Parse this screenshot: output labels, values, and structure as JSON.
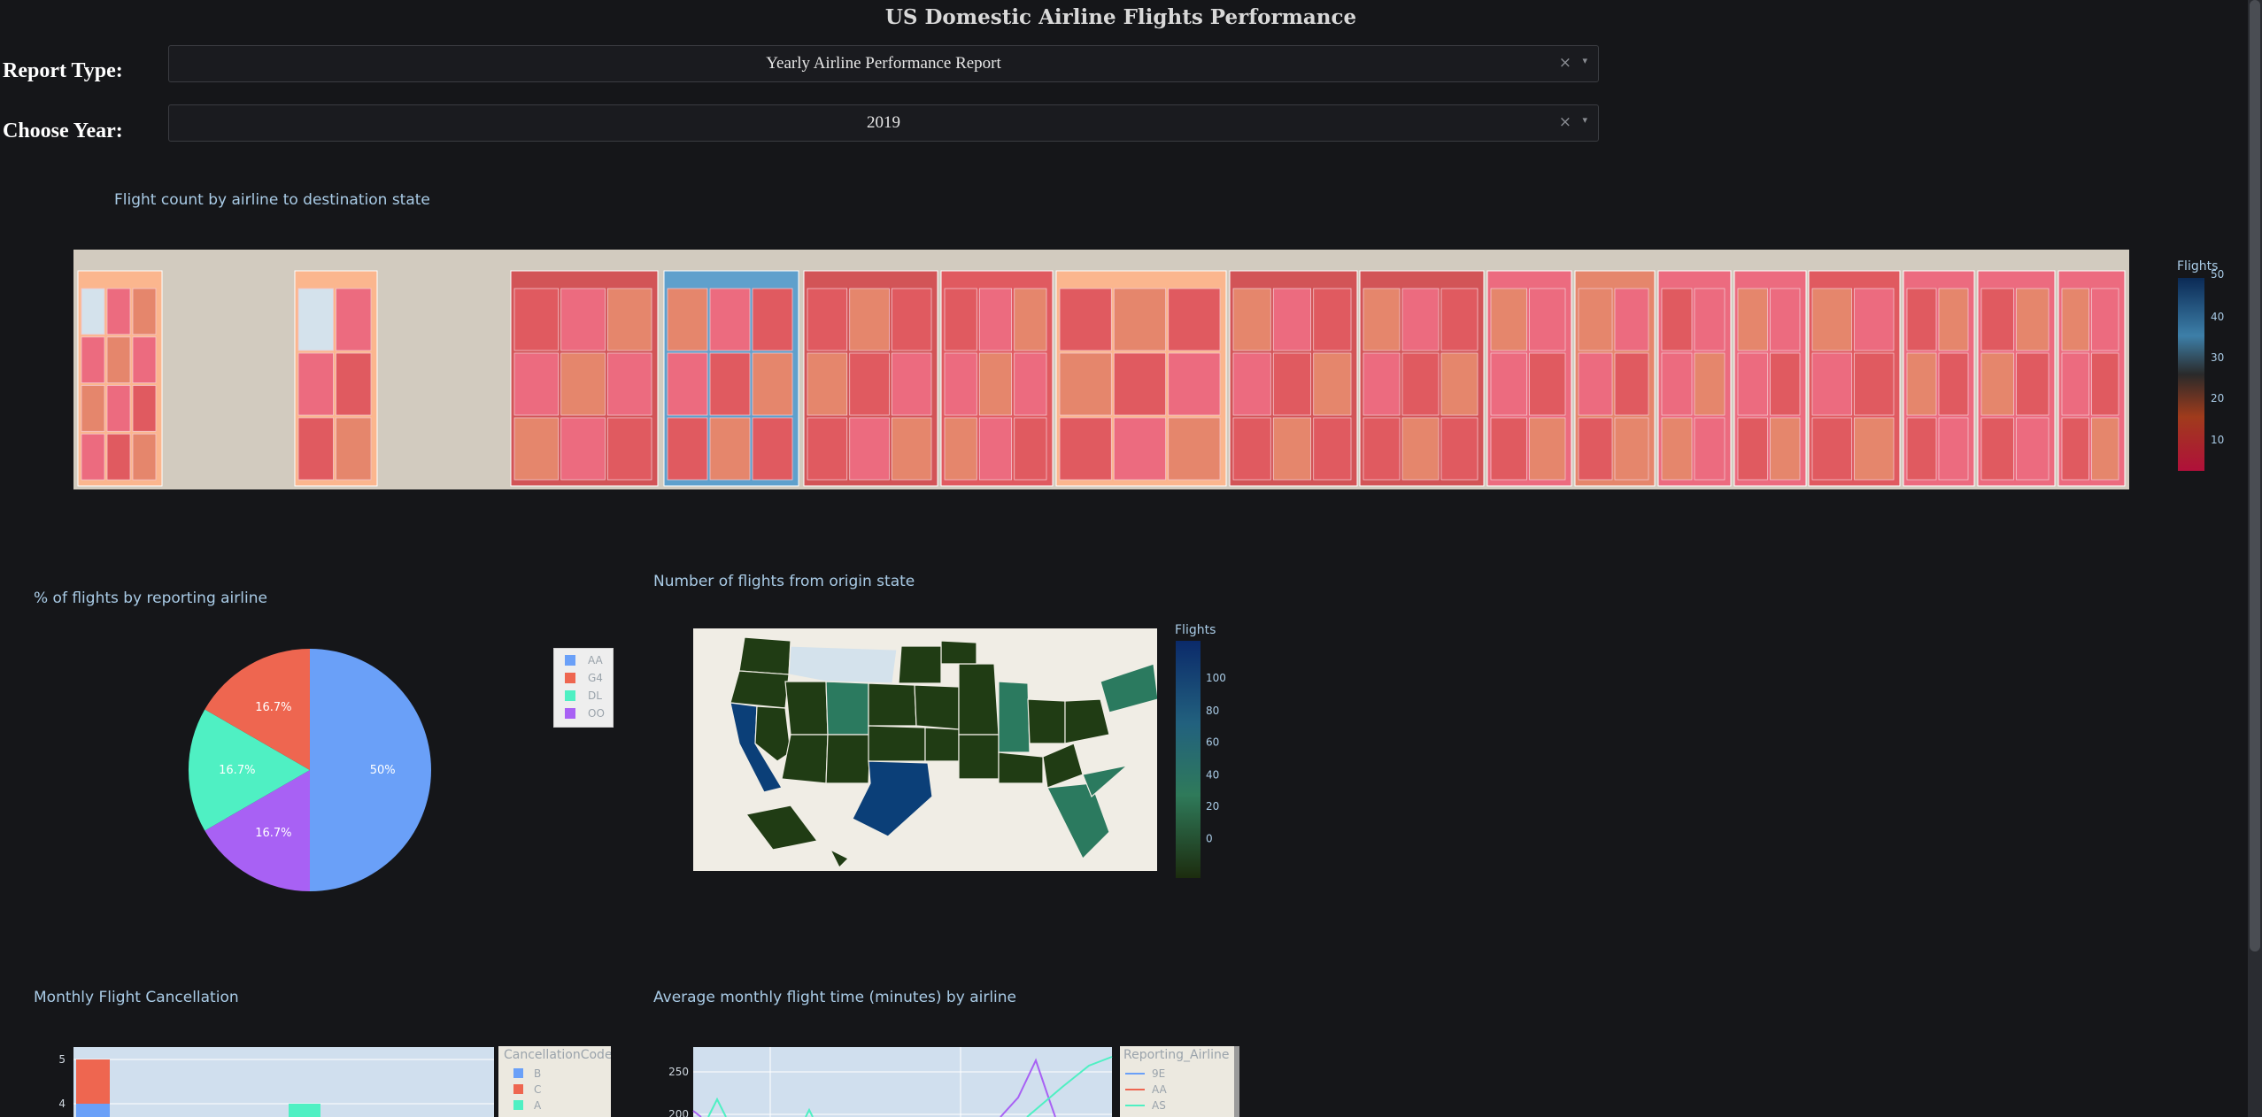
{
  "header": {
    "title": "US Domestic Airline Flights Performance"
  },
  "controls": {
    "report_label": "Report Type:",
    "report_value": "Yearly Airline Performance Report",
    "year_label": "Choose Year:",
    "year_value": "2019",
    "clear_glyph": "×",
    "caret_glyph": "▾"
  },
  "treemap": {
    "title": "Flight count by airline to destination state",
    "colorbar_title": "Flights",
    "colorbar_ticks": [
      "50",
      "40",
      "30",
      "20",
      "10"
    ],
    "colors": {
      "root": "#d2cbbf",
      "dark_red": "#d25457",
      "red": "#e05a60",
      "pink": "#ec6b7f",
      "salmon": "#e5866c",
      "peach": "#fbb68e",
      "light": "#d4e2ec",
      "blue": "#5fa0cc"
    }
  },
  "pie": {
    "title": "% of flights by reporting airline",
    "slice_labels": [
      "50%",
      "16.7%",
      "16.7%",
      "16.7%"
    ],
    "legend": [
      "AA",
      "G4",
      "DL",
      "OO"
    ],
    "colors": [
      "#6aa0f8",
      "#ee6650",
      "#4ff0c3",
      "#a861f4"
    ]
  },
  "map": {
    "title": "Number of flights from origin state",
    "colorbar_title": "Flights",
    "colorbar_ticks": [
      "100",
      "80",
      "60",
      "40",
      "20",
      "0"
    ],
    "colors": {
      "land": "#f0ede5",
      "low": "#203c14",
      "mid": "#2b7a5f",
      "high": "#0b3f78"
    }
  },
  "cancel": {
    "title": "Monthly Flight Cancellation",
    "legend_title": "CancellationCode",
    "legend": [
      "B",
      "C",
      "A"
    ],
    "legend_colors": [
      "#6aa0f8",
      "#ee6650",
      "#4ff0c3"
    ],
    "yticks": [
      "5",
      "4"
    ]
  },
  "airtime": {
    "title": "Average monthly flight time (minutes) by airline",
    "legend_title": "Reporting_Airline",
    "legend": [
      "9E",
      "AA",
      "AS"
    ],
    "legend_colors": [
      "#6aa0f8",
      "#ee6650",
      "#4ff0c3"
    ],
    "yticks": [
      "250",
      "200"
    ]
  }
}
